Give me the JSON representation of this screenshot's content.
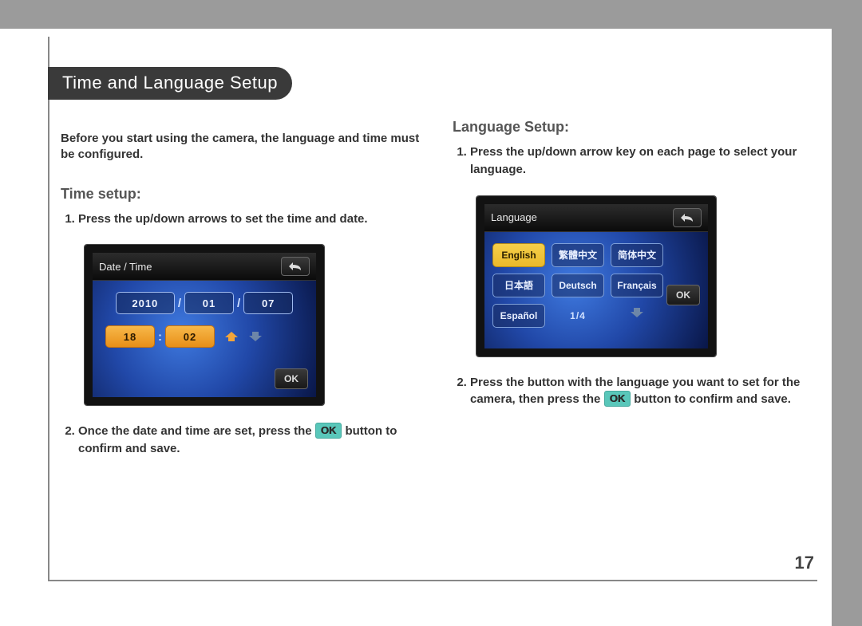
{
  "section_title": "Time and Language Setup",
  "page_number": "17",
  "intro_text": "Before you start using the camera, the language and time must be configured.",
  "time_setup": {
    "heading": "Time setup:",
    "step1": "Press the up/down arrows to set the time and date.",
    "step2_before": "Once the date and time are set, press the ",
    "step2_after": " button to confirm and save.",
    "ok_label": "OK"
  },
  "language_setup": {
    "heading": "Language Setup:",
    "step1": "Press the up/down arrow key on each page to select your language.",
    "step2_before": "Press the button with the language you want to set for the camera, then press the ",
    "step2_after": " button to confirm and save.",
    "ok_label": "OK"
  },
  "lcd_time": {
    "title": "Date / Time",
    "year": "2010",
    "month": "01",
    "day": "07",
    "hour": "18",
    "minute": "02",
    "ok": "OK"
  },
  "lcd_lang": {
    "title": "Language",
    "options": [
      "English",
      "繁體中文",
      "简体中文",
      "日本語",
      "Deutsch",
      "Français",
      "Español"
    ],
    "page": "1/4",
    "ok": "OK"
  }
}
